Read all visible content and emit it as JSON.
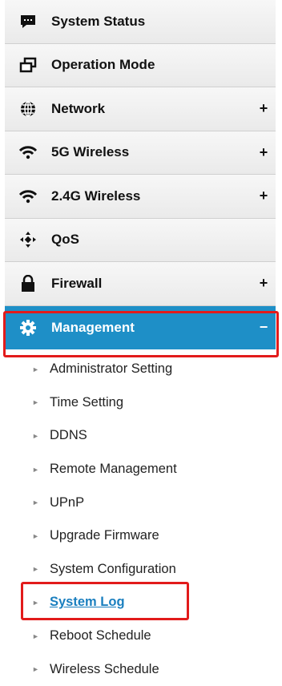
{
  "menu": {
    "items": [
      {
        "label": "System Status",
        "icon": "chat-bubble-icon",
        "expand": ""
      },
      {
        "label": "Operation Mode",
        "icon": "windows-icon",
        "expand": ""
      },
      {
        "label": "Network",
        "icon": "globe-icon",
        "expand": "+"
      },
      {
        "label": "5G Wireless",
        "icon": "wifi-icon",
        "expand": "+"
      },
      {
        "label": "2.4G Wireless",
        "icon": "wifi-icon",
        "expand": "+"
      },
      {
        "label": "QoS",
        "icon": "qos-icon",
        "expand": ""
      },
      {
        "label": "Firewall",
        "icon": "lock-icon",
        "expand": "+"
      },
      {
        "label": "Management",
        "icon": "gear-icon",
        "expand": "−",
        "active": true
      }
    ],
    "submenu": [
      {
        "label": "Administrator Setting"
      },
      {
        "label": "Time Setting"
      },
      {
        "label": "DDNS"
      },
      {
        "label": "Remote Management"
      },
      {
        "label": "UPnP"
      },
      {
        "label": "Upgrade Firmware"
      },
      {
        "label": "System Configuration"
      },
      {
        "label": "System Log",
        "current": true
      },
      {
        "label": "Reboot Schedule"
      },
      {
        "label": "Wireless Schedule"
      }
    ],
    "colors": {
      "active_bg": "#1e8fc7",
      "highlight_border": "#e21b1b",
      "link": "#1a7fbf"
    }
  }
}
